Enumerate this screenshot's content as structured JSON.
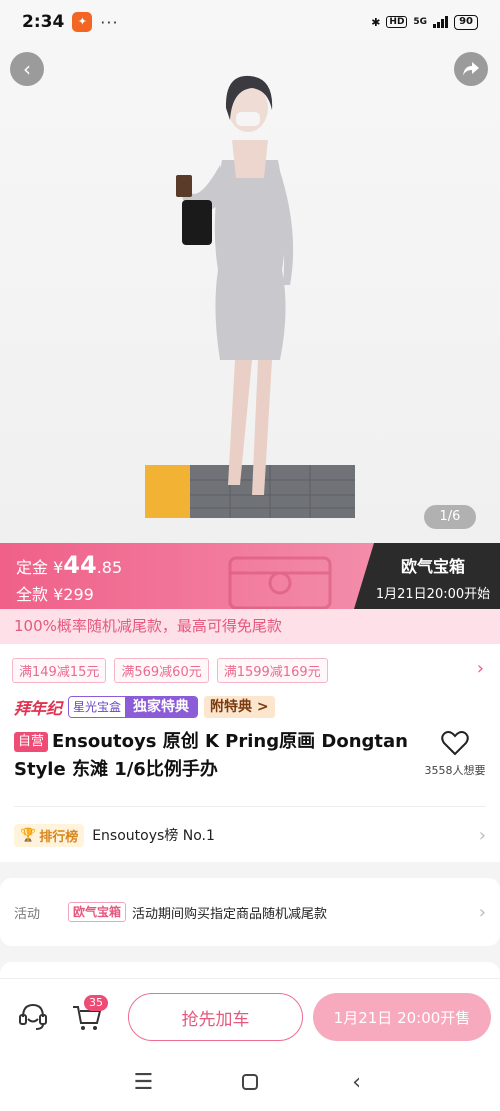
{
  "status_bar": {
    "time": "2:34",
    "app_icon": "app-notification-icon",
    "dots": "···",
    "hd": "HD",
    "network": "5G",
    "battery": "90"
  },
  "hero": {
    "image_counter": "1/6",
    "image_subject": "anime-figure-woman-gray-dress"
  },
  "presale": {
    "deposit_label": "定金 ¥",
    "deposit_amount_int": "44",
    "deposit_amount_dec": ".85",
    "full_label": "全款 ¥299",
    "box_title": "欧气宝箱",
    "box_time": "1月21日20:00开始"
  },
  "promo_strip": "100%概率随机减尾款，最高可得免尾款",
  "coupons": [
    "满149减15元",
    "满569减60元",
    "满1599减169元"
  ],
  "badges": {
    "cny": "拜年纪",
    "star_left": "星光宝盒",
    "star_right": "独家特典",
    "gift": "附特典 >"
  },
  "product": {
    "self_tag": "自营",
    "title": "Ensoutoys 原创 K Pring原画 Dongtan Style 东滩 1/6比例手办",
    "fav_count": "3558人想要"
  },
  "ranking": {
    "badge": "排行榜",
    "text": "Ensoutoys榜 No.1"
  },
  "activity": {
    "label": "活动",
    "tag": "欧气宝箱",
    "text": "活动期间购买指定商品随机减尾款"
  },
  "bottom_bar": {
    "cart_count": "35",
    "add_cart": "抢先加车",
    "presale_btn": "1月21日 20:00开售"
  },
  "colors": {
    "pink": "#ee4b75",
    "pink_light": "#fde0e8",
    "dark": "#2b2b2b"
  }
}
